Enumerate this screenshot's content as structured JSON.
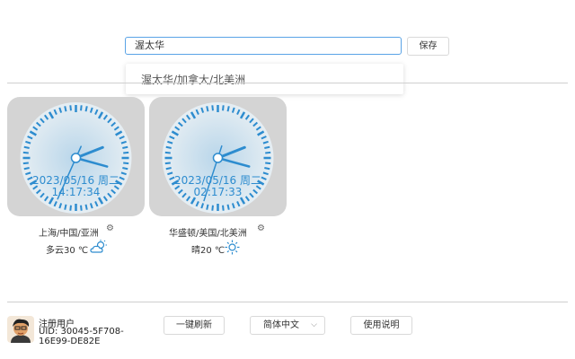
{
  "search": {
    "value": "渥太华"
  },
  "save_label": "保存",
  "suggestion": "渥太华/加拿大/北美洲",
  "clocks": [
    {
      "date": "2023/05/16 周二",
      "time": "14:17:34",
      "city": "上海/中国/亚洲",
      "weather": "多云30 ℃",
      "weather_icon": "partly-cloudy-icon"
    },
    {
      "date": "2023/05/16 周二",
      "time": "02:17:33",
      "city": "华盛顿/美国/北美洲",
      "weather": "晴20 ℃",
      "weather_icon": "sun-icon"
    }
  ],
  "user": {
    "name": "注册用户",
    "uid": "UID: 30045-5F708-16E99-DE82E"
  },
  "buttons": {
    "refresh": "一键刷新",
    "language": "简体中文",
    "help": "使用说明"
  },
  "colors": {
    "accent": "#2d8ccf",
    "clock_bg": "#d4d4d4"
  }
}
